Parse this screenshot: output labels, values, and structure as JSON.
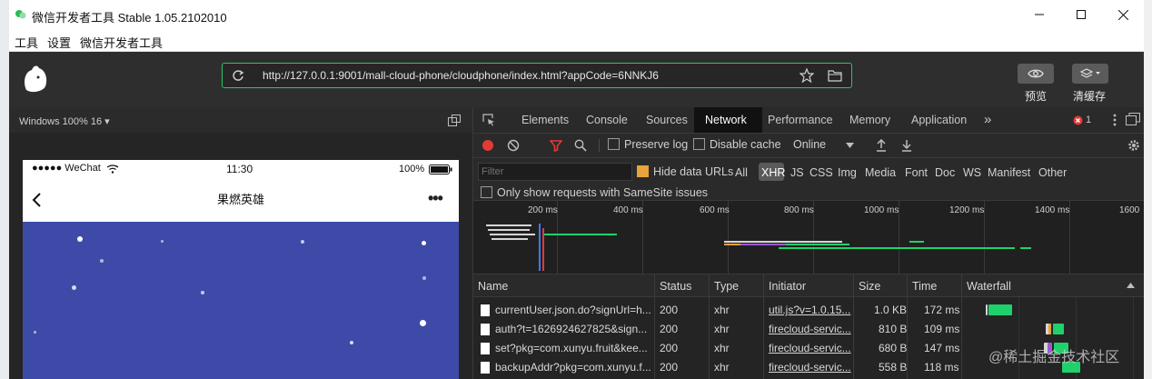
{
  "window": {
    "title": "微信开发者工具 Stable 1.05.2102010",
    "menu": [
      "工具",
      "设置",
      "微信开发者工具"
    ]
  },
  "toolbar": {
    "url": "http://127.0.0.1:9001/mall-cloud-phone/cloudphone/index.html?appCode=6NNKJ6",
    "preview_label": "预览",
    "clear_cache_label": "清缓存"
  },
  "simulator": {
    "device_label": "Windows 100% 16 ▾",
    "status": {
      "carrier": "●●●●● WeChat",
      "time": "11:30",
      "battery": "100%"
    },
    "page_title": "果燃英雄",
    "more": "•••",
    "accent_color": "#3e4aa8"
  },
  "devtools": {
    "tabs": [
      "Elements",
      "Console",
      "Sources",
      "Network",
      "Performance",
      "Memory",
      "Application"
    ],
    "more_tabs": "»",
    "active_tab": "Network",
    "error_count": "1",
    "controls": {
      "preserve_log": "Preserve log",
      "disable_cache": "Disable cache",
      "throttle": "Online"
    },
    "filter": {
      "placeholder": "Filter",
      "hide_data_urls": "Hide data URLs",
      "types": [
        "All",
        "XHR",
        "JS",
        "CSS",
        "Img",
        "Media",
        "Font",
        "Doc",
        "WS",
        "Manifest",
        "Other"
      ],
      "active_type": "XHR",
      "samesite": "Only show requests with SameSite issues"
    },
    "overview_ticks": [
      "200 ms",
      "400 ms",
      "600 ms",
      "800 ms",
      "1000 ms",
      "1200 ms",
      "1400 ms",
      "1600"
    ],
    "columns": [
      "Name",
      "Status",
      "Type",
      "Initiator",
      "Size",
      "Time",
      "Waterfall"
    ],
    "rows": [
      {
        "name": "currentUser.json.do?signUrl=h...",
        "status": "200",
        "type": "xhr",
        "initiator": "util.js?v=1.0.15...",
        "size": "1.0 KB",
        "time": "172 ms"
      },
      {
        "name": "auth?t=1626924627825&sign...",
        "status": "200",
        "type": "xhr",
        "initiator": "firecloud-servic...",
        "size": "810 B",
        "time": "109 ms"
      },
      {
        "name": "set?pkg=com.xunyu.fruit&kee...",
        "status": "200",
        "type": "xhr",
        "initiator": "firecloud-servic...",
        "size": "680 B",
        "time": "147 ms"
      },
      {
        "name": "backupAddr?pkg=com.xunyu.f...",
        "status": "200",
        "type": "xhr",
        "initiator": "firecloud-servic...",
        "size": "558 B",
        "time": "118 ms"
      }
    ]
  },
  "watermark": "@稀土掘金技术社区"
}
